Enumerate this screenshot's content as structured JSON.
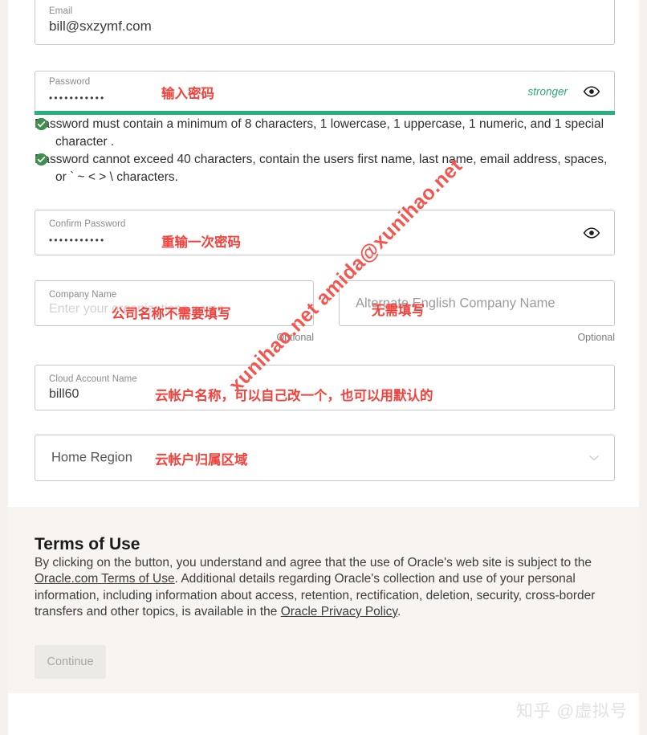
{
  "form": {
    "email": {
      "label": "Email",
      "value": "bill@sxzymf.com"
    },
    "password": {
      "label": "Password",
      "value": "•••••••••••",
      "strength_text": "stronger",
      "strength_color": "#26b07f",
      "reveal_icon": "eye-icon",
      "requirements": [
        {
          "status_icon": "check-circle-icon",
          "text": "Password must contain a minimum of 8 characters, 1 lowercase, 1 uppercase, 1 numeric, and 1 special character ."
        },
        {
          "status_icon": "check-circle-icon",
          "text": "Password cannot exceed 40 characters, contain the users first name, last name, email address, spaces, or ` ~ < > \\ characters."
        }
      ]
    },
    "confirm_password": {
      "label": "Confirm Password",
      "value": "•••••••••••",
      "reveal_icon": "eye-icon"
    },
    "company_name": {
      "label": "Company Name",
      "placeholder": "Enter your organizations name",
      "value": "",
      "optional_note": "Optional"
    },
    "alternate_company_name": {
      "placeholder": "Alternate English Company Name",
      "value": "",
      "optional_note": "Optional"
    },
    "cloud_account_name": {
      "label": "Cloud Account Name",
      "value": "bill60"
    },
    "home_region": {
      "label": "Home Region",
      "value": "",
      "chevron_icon": "chevron-down-icon"
    }
  },
  "terms": {
    "title": "Terms of Use",
    "paragraph_part1": "By clicking on the button, you understand and agree that the use of Oracle's web site is subject to the ",
    "link1": "Oracle.com Terms of Use",
    "paragraph_part2": ". Additional details regarding Oracle's collection and use of your personal information, including information about access, retention, rectification, deletion, security, cross-border transfers and other topics, is available in the ",
    "link2": "Oracle Privacy Policy",
    "paragraph_part3": "."
  },
  "actions": {
    "continue_label": "Continue"
  },
  "annotations": {
    "password": "输入密码",
    "confirm_password": "重输一次密码",
    "company_name": "公司名称不需要填写",
    "alternate_company_name": "无需填写",
    "cloud_account_name": "云帐户名称，可以自己改一个，也可以用默认的",
    "home_region": "云帐户归属区域",
    "annotation_color": "#f4413b"
  },
  "watermarks": {
    "url": "xunihao.net amida@xunihao.net",
    "site": "知乎 @虚拟号"
  }
}
